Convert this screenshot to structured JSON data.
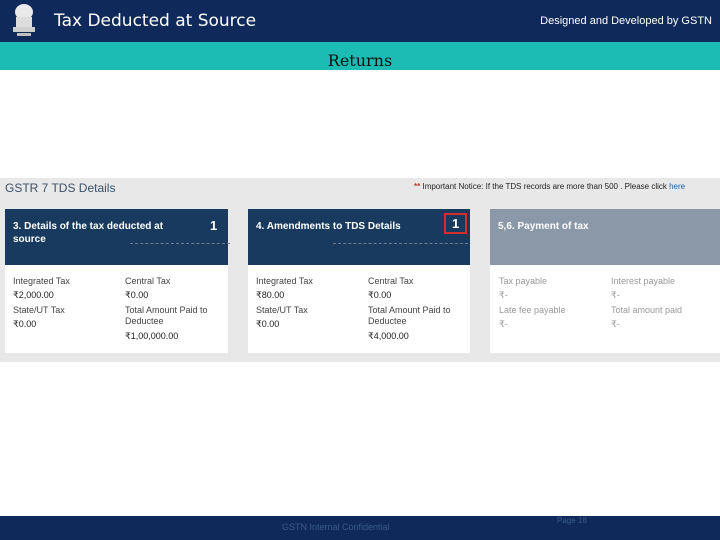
{
  "header": {
    "title": "Tax Deducted at Source",
    "credit": "Designed and Developed by GSTN"
  },
  "section": {
    "title": "Returns"
  },
  "panel": {
    "title": "GSTR 7 TDS Details",
    "notice_star": "**",
    "notice_text": "Important Notice: If the TDS records are more than 500 . Please click",
    "notice_link": "here"
  },
  "tiles": [
    {
      "title": "3. Details of the tax deducted at source",
      "count": "1",
      "fields": [
        {
          "label": "Integrated Tax",
          "value": "₹2,000.00"
        },
        {
          "label": "Central Tax",
          "value": "₹0.00"
        },
        {
          "label": "State/UT Tax",
          "value": "₹0.00"
        },
        {
          "label": "Total Amount Paid to Deductee",
          "value": "₹1,00,000.00"
        }
      ]
    },
    {
      "title": "4. Amendments to TDS Details",
      "count": "1",
      "fields": [
        {
          "label": "Integrated Tax",
          "value": "₹80.00"
        },
        {
          "label": "Central Tax",
          "value": "₹0.00"
        },
        {
          "label": "State/UT Tax",
          "value": "₹0.00"
        },
        {
          "label": "Total Amount Paid to Deductee",
          "value": "₹4,000.00"
        }
      ]
    },
    {
      "title": "5,6. Payment of tax",
      "fields": [
        {
          "label": "Tax payable",
          "value": "₹-"
        },
        {
          "label": "Interest payable",
          "value": "₹-"
        },
        {
          "label": "Late fee payable",
          "value": "₹-"
        },
        {
          "label": "Total amount paid",
          "value": "₹-"
        }
      ]
    }
  ],
  "footer": {
    "text": "GSTN Internal Confidential",
    "page": "Page 18"
  },
  "colors": {
    "header_bg": "#0f2a5a",
    "subbar_bg": "#1cbbb4",
    "tile_head": "#173a5e",
    "tile_head_disabled": "#8a98a8",
    "highlight": "#d32f2f"
  }
}
